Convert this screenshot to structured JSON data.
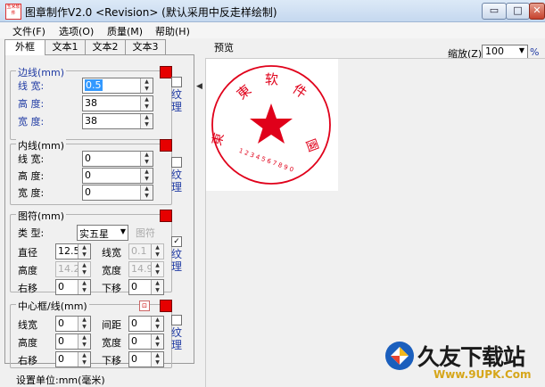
{
  "title": "图章制作V2.0 <Revision> (默认采用中反走样绘制)",
  "app_icon_text": "玉米软件",
  "window_buttons": {
    "minimize": "▭",
    "maximize": "□",
    "close": "✕"
  },
  "menu": [
    "文件(F)",
    "选项(O)",
    "质量(M)",
    "帮助(H)"
  ],
  "tabs": [
    "外框",
    "文本1",
    "文本2",
    "文本3"
  ],
  "border_group": {
    "title": "边线(mm)",
    "rows": [
      {
        "label": "线  宽:",
        "value": "0.5"
      },
      {
        "label": "高  度:",
        "value": "38"
      },
      {
        "label": "宽  度:",
        "value": "38"
      }
    ],
    "texture_label": "纹理",
    "color": "#e60000"
  },
  "inner_group": {
    "title": "内线(mm)",
    "rows": [
      {
        "label": "线  宽:",
        "value": "0"
      },
      {
        "label": "高  度:",
        "value": "0"
      },
      {
        "label": "宽  度:",
        "value": "0"
      }
    ],
    "texture_label": "纹理"
  },
  "symbol_group": {
    "title": "图符(mm)",
    "type_label": "类  型:",
    "type_value": "实五星",
    "symbol_button": "图符",
    "diameter_label": "直径",
    "diameter_value": "12.5",
    "linewidth_label": "线宽",
    "linewidth_value": "0.1",
    "height_label": "高度",
    "height_value": "14.2",
    "width_label": "宽度",
    "width_value": "14.9",
    "right_label": "右移",
    "right_value": "0",
    "down_label": "下移",
    "down_value": "0",
    "texture_label": "纹理",
    "texture_checked": "✓"
  },
  "center_group": {
    "title": "中心框/线(mm)",
    "linewidth_label": "线宽",
    "linewidth_value": "0",
    "spacing_label": "间距",
    "spacing_value": "0",
    "height_label": "高度",
    "height_value": "0",
    "width_label": "宽度",
    "width_value": "0",
    "right_label": "右移",
    "right_value": "0",
    "down_label": "下移",
    "down_value": "0",
    "texture_label": "纹理"
  },
  "units_label": "设置单位:mm(毫米)",
  "preview": {
    "title": "预览",
    "zoom_label": "缩放(Z)",
    "zoom_value": "100",
    "zoom_unit": "%"
  },
  "stamp": {
    "chars": [
      "東",
      "软",
      "件",
      "東",
      "園"
    ],
    "serial": "1 2 3 4 5 6 7 8 9 0",
    "color": "#e0001a"
  },
  "watermark": {
    "main": "久友下载站",
    "url": "Www.9UPK.Com"
  }
}
